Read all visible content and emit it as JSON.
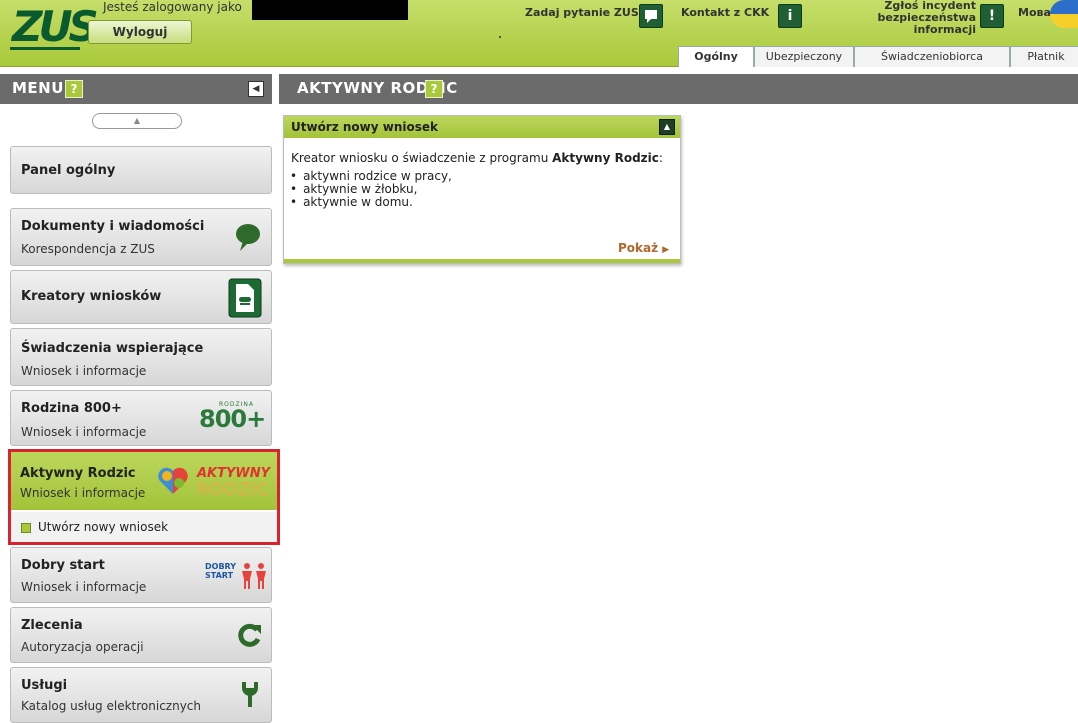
{
  "header": {
    "logo_text": "ZUS",
    "logged_label": "Jesteś zalogowany jako",
    "logout_label": "Wyloguj",
    "ask_label": "Zadaj pytanie ZUS",
    "contact_label": "Kontakt z CKK",
    "incident_line1": "Zgłoś incydent",
    "incident_line2": "bezpieczeństwa informacji",
    "lang_label": "Мова",
    "accent_color": "#a9c93a"
  },
  "tabs": [
    "Ogólny",
    "Ubezpieczony",
    "Świadczeniobiorca",
    "Płatnik"
  ],
  "menu": {
    "title": "MENU",
    "help": "?",
    "items": [
      {
        "title": "Panel ogólny",
        "subtitle": "",
        "icon": "none"
      },
      {
        "title": "Dokumenty i wiadomości",
        "subtitle": "Korespondencja z ZUS",
        "icon": "speech-bubble-icon"
      },
      {
        "title": "Kreatory wniosków",
        "subtitle": "",
        "icon": "document-form-icon"
      },
      {
        "title": "Świadczenia wspierające",
        "subtitle": "Wniosek i informacje",
        "icon": "none"
      },
      {
        "title": "Rodzina 800+",
        "subtitle": "Wniosek i informacje",
        "icon": "rodzina-800-logo"
      },
      {
        "title": "Aktywny Rodzic",
        "subtitle": "Wniosek i informacje",
        "icon": "aktywny-rodzic-logo"
      },
      {
        "title": "Dobry start",
        "subtitle": "Wniosek i informacje",
        "icon": "dobry-start-logo"
      },
      {
        "title": "Zlecenia",
        "subtitle": "Autoryzacja operacji",
        "icon": "refresh-icon"
      },
      {
        "title": "Usługi",
        "subtitle": "Katalog usług elektronicznych",
        "icon": "plug-icon"
      }
    ],
    "active_subitem": "Utwórz nowy wniosek",
    "logos": {
      "rodzina_top": "RODZINA",
      "rodzina_number": "800+",
      "aktywny_word1": "AKTYWNY",
      "aktywny_word2": "RODZIC",
      "dobry_word1": "DOBRY",
      "dobry_word2": "START"
    }
  },
  "main": {
    "title": "AKTYWNY RODZIC",
    "help": "?",
    "box": {
      "title": "Utwórz nowy wniosek",
      "intro_prefix": "Kreator wniosku o świadczenie z programu ",
      "intro_bold": "Aktywny Rodzic",
      "intro_suffix": ":",
      "bullets": [
        "aktywni rodzice w pracy,",
        "aktywnie w żłobku,",
        "aktywnie w domu."
      ],
      "show_label": "Pokaż"
    }
  },
  "highlight_color": "#d9242f"
}
